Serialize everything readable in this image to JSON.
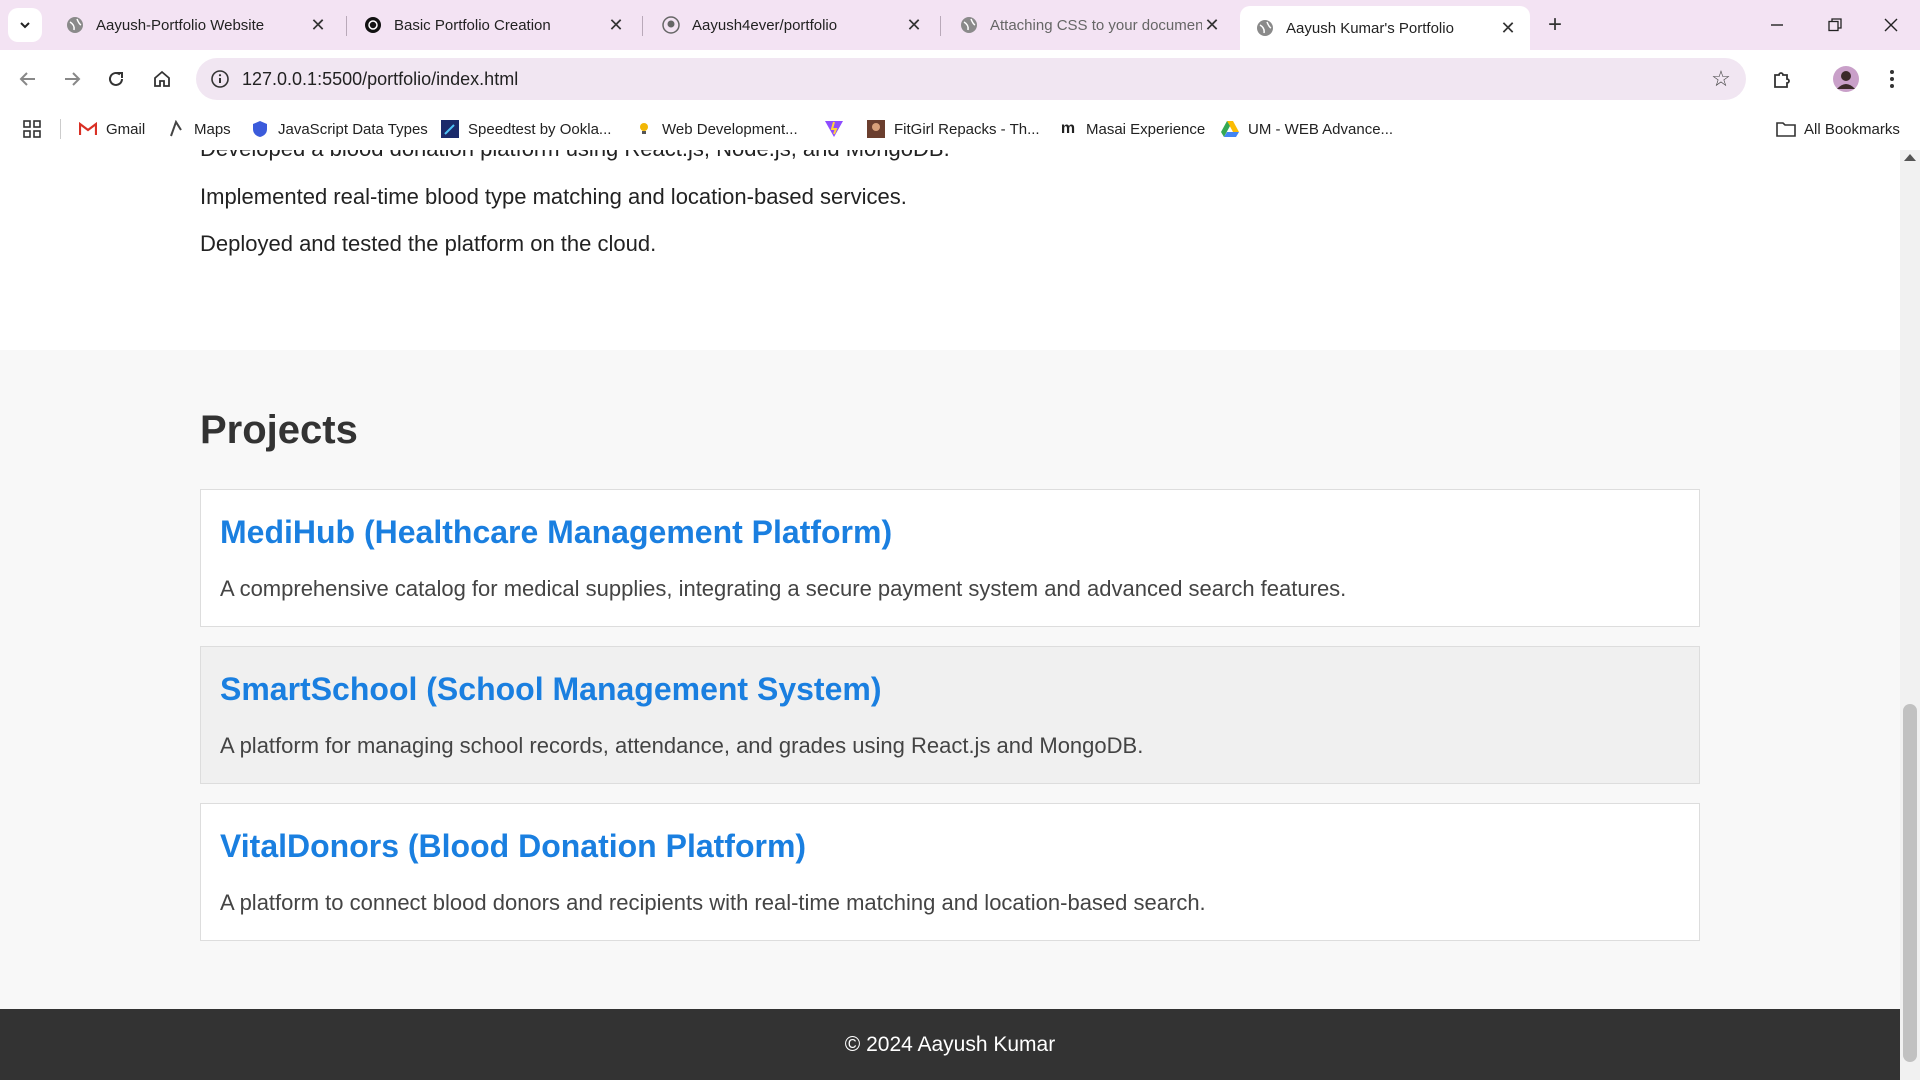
{
  "browser": {
    "tabs": [
      {
        "title": "Aayush-Portfolio Website",
        "icon": "globe-icon",
        "active": false
      },
      {
        "title": "Basic Portfolio Creation",
        "icon": "chatgpt-icon",
        "active": false
      },
      {
        "title": "Aayush4ever/portfolio",
        "icon": "github-icon",
        "active": false
      },
      {
        "title": "Attaching CSS to your documen",
        "icon": "globe-icon",
        "active": false
      },
      {
        "title": "Aayush Kumar's Portfolio",
        "icon": "globe-icon",
        "active": true
      }
    ],
    "url": "127.0.0.1:5500/portfolio/index.html",
    "bookmarks": [
      {
        "label": "Gmail",
        "icon": "gmail-icon"
      },
      {
        "label": "Maps",
        "icon": "maps-icon"
      },
      {
        "label": "JavaScript Data Types",
        "icon": "shield-icon"
      },
      {
        "label": "Speedtest by Ookla...",
        "icon": "speedtest-icon"
      },
      {
        "label": "Web Development...",
        "icon": "bulb-icon"
      },
      {
        "label": "",
        "icon": "vite-icon"
      },
      {
        "label": "FitGirl Repacks - Th...",
        "icon": "fitgirl-icon"
      },
      {
        "label": "Masai Experience",
        "icon": "masai-icon"
      },
      {
        "label": "UM - WEB Advance...",
        "icon": "drive-icon"
      }
    ],
    "all_bookmarks": "All Bookmarks"
  },
  "experience": {
    "lines": [
      "Developed a blood donation platform using React.js, Node.js, and MongoDB.",
      "Implemented real-time blood type matching and location-based services.",
      "Deployed and tested the platform on the cloud."
    ]
  },
  "projects": {
    "heading": "Projects",
    "items": [
      {
        "title": "MediHub (Healthcare Management Platform)",
        "description": "A comprehensive catalog for medical supplies, integrating a secure payment system and advanced search features."
      },
      {
        "title": "SmartSchool (School Management System)",
        "description": "A platform for managing school records, attendance, and grades using React.js and MongoDB."
      },
      {
        "title": "VitalDonors (Blood Donation Platform)",
        "description": "A platform to connect blood donors and recipients with real-time matching and location-based search."
      }
    ]
  },
  "footer": {
    "text": "© 2024 Aayush Kumar"
  },
  "colors": {
    "tabbar_bg": "#f3e3f3",
    "project_title": "#1a7fe0",
    "footer_bg": "#333333",
    "projects_bg": "#f8f8f8"
  }
}
